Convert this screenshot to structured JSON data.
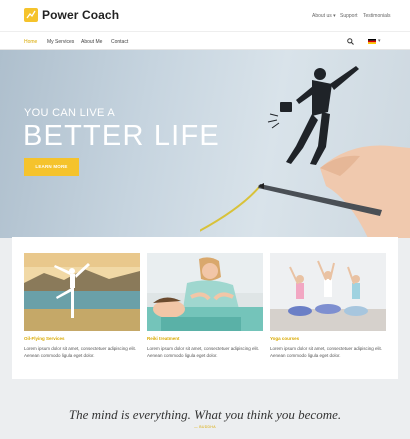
{
  "brand": {
    "name": "Power Coach",
    "accent": "#f5c32c"
  },
  "utility_nav": {
    "about": "About us",
    "support": "Support",
    "testimonials": "Testimonials"
  },
  "main_nav": {
    "home": "Home",
    "services": "My Services",
    "about_me": "About Me",
    "contact": "Contact"
  },
  "hero": {
    "pre_title": "YOU CAN LIVE A",
    "title": "BETTER LIFE",
    "button": "LEARN MORE"
  },
  "cards": [
    {
      "title": "Oil-Flying Services",
      "text": "Lorem ipsum dolor sit amet, consectetuer adipiscing elit. Aenean commodo ligula eget dolor."
    },
    {
      "title": "Reiki treatment",
      "text": "Lorem ipsum dolor sit amet, consectetuer adipiscing elit. Aenean commodo ligula eget dolor."
    },
    {
      "title": "Yoga courses",
      "text": "Lorem ipsum dolor sit amet, consectetuer adipiscing elit. Aenean commodo ligula eget dolor."
    }
  ],
  "quote": {
    "text": "The mind is everything. What you think you become.",
    "author": "— BUDDHA"
  },
  "icons": {
    "search": "search-icon",
    "flag": "german-flag-icon",
    "logo": "logo-icon"
  }
}
